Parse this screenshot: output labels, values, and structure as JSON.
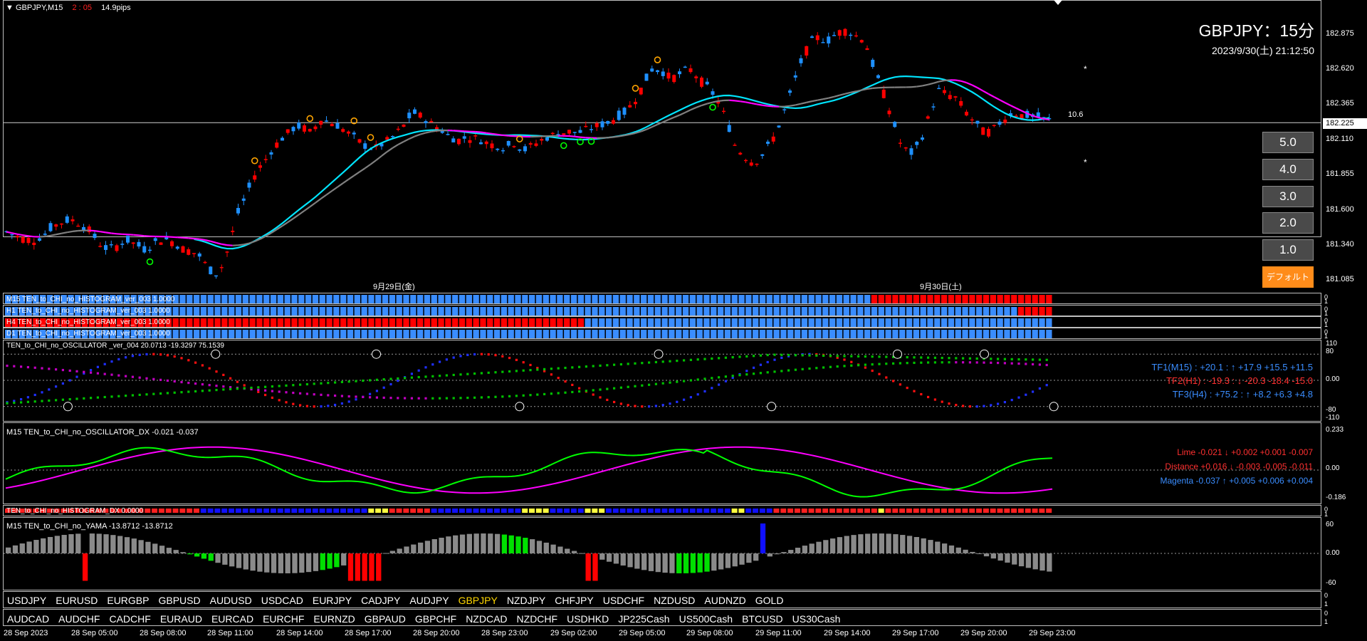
{
  "chart_header": {
    "symbol_tf": "GBPJPY,M15",
    "countdown": "2 : 05",
    "spread": "14.9pips"
  },
  "title_box": {
    "title": "GBPJPY：15分",
    "datetime": "2023/9/30(土) 21:12:50"
  },
  "price_axis": {
    "labels": [
      "182.875",
      "182.620",
      "182.365",
      "182.110",
      "181.855",
      "181.600",
      "181.340",
      "181.085"
    ],
    "current_price": "182.225",
    "current_price_value": 182.225
  },
  "spread_label": "10.6",
  "asterisks": [
    "*",
    "*"
  ],
  "scale_buttons": [
    "5.0",
    "4.0",
    "3.0",
    "2.0",
    "1.0",
    "デフォルト"
  ],
  "day_labels": [
    "9月29日(金)",
    "9月30日(土)"
  ],
  "histograms": [
    "M15 TEN_to_CHI_no_HISTOGRAM_ver_003 1.0000",
    "H1 TEN_to_CHI_no_HISTOGRAM_ver_003 1.0000",
    "H4 TEN_to_CHI_no_HISTOGRAM_ver_003 1.0000",
    "D1 TEN_to_CHI_no_HISTOGRAM_ver_003 1.0000"
  ],
  "hist_axis": [
    "0",
    "1"
  ],
  "oscillator": {
    "title": "TEN_to_CHI_no_OSCILLATOR _ver_004 20.0713 -19.3297 75.1539",
    "axis": [
      "110",
      "80",
      "0.00",
      "-80",
      "-110"
    ],
    "rows": [
      {
        "text": "TF1(M15) : +20.1 : ↑ +17.9 +15.5 +11.5",
        "color": "#3a8dff"
      },
      {
        "text": "TF2(H1) : -19.3 : ↓ -20.3 -18.4 -15.0",
        "color": "#ff3030"
      },
      {
        "text": "TF3(H4) : +75.2 : ↑ +8.2 +6.3 +4.8",
        "color": "#3a8dff"
      }
    ]
  },
  "dx": {
    "title": "M15 TEN_to_CHI_no_OSCILLATOR_DX -0.021 -0.037",
    "axis": [
      "0.233",
      "0.00",
      "-0.186"
    ],
    "rows": [
      {
        "text": "Lime -0.021 ↓ +0.002 +0.001 -0.007",
        "color": "#ff3030"
      },
      {
        "text": "Distance +0.016 ↓ -0.003 -0.005 -0.011",
        "color": "#ff3030"
      },
      {
        "text": "Magenta -0.037 ↑ +0.005 +0.006 +0.004",
        "color": "#3a8dff"
      }
    ]
  },
  "dx_hist": {
    "title": "TEN_to_CHI_no_HISTOGRAM_DX 0.0000",
    "axis": [
      "0",
      "1"
    ]
  },
  "yama": {
    "title": "M15 TEN_to_CHI_no_YAMA -13.8712 -13.8712",
    "axis": [
      "60",
      "0.00",
      "-60"
    ]
  },
  "symbols_row1": {
    "items": [
      "USDJPY",
      "EURUSD",
      "EURGBP",
      "GBPUSD",
      "AUDUSD",
      "USDCAD",
      "EURJPY",
      "CADJPY",
      "AUDJPY",
      "GBPJPY",
      "NZDJPY",
      "CHFJPY",
      "USDCHF",
      "NZDUSD",
      "AUDNZD",
      "GOLD"
    ],
    "active": "GBPJPY",
    "axis": [
      "0",
      "1"
    ]
  },
  "symbols_row2": {
    "items": [
      "AUDCAD",
      "AUDCHF",
      "CADCHF",
      "EURAUD",
      "EURCAD",
      "EURCHF",
      "EURNZD",
      "GBPAUD",
      "GBPCHF",
      "NZDCAD",
      "NZDCHF",
      "USDHKD",
      "JP225Cash",
      "US500Cash",
      "BTCUSD",
      "US30Cash"
    ],
    "axis": [
      "0",
      "1"
    ]
  },
  "time_axis": [
    "28 Sep 2023",
    "28 Sep 05:00",
    "28 Sep 08:00",
    "28 Sep 11:00",
    "28 Sep 14:00",
    "28 Sep 17:00",
    "28 Sep 20:00",
    "28 Sep 23:00",
    "29 Sep 02:00",
    "29 Sep 05:00",
    "29 Sep 08:00",
    "29 Sep 11:00",
    "29 Sep 14:00",
    "29 Sep 17:00",
    "29 Sep 20:00",
    "29 Sep 23:00"
  ],
  "colors": {
    "bull": "#1e90ff",
    "bear": "#ff0000",
    "ma_fast": "#00e5ff",
    "ma_slow_up": "#808080",
    "ma_slow_down": "#ff00ff",
    "lime": "#00ff00",
    "magenta": "#ff00ff",
    "active_symbol": "#ffd700"
  },
  "price_path": [
    181.43,
    181.4,
    181.38,
    181.37,
    181.4,
    181.47,
    181.5,
    181.52,
    181.49,
    181.44,
    181.35,
    181.3,
    181.33,
    181.37,
    181.34,
    181.3,
    181.35,
    181.38,
    181.36,
    181.31,
    181.29,
    181.25,
    181.15,
    181.12,
    181.3,
    181.55,
    181.7,
    181.86,
    181.95,
    182.05,
    182.12,
    182.18,
    182.2,
    182.15,
    182.25,
    182.23,
    182.2,
    182.15,
    182.1,
    182.05,
    182.04,
    182.08,
    182.13,
    182.2,
    182.3,
    182.27,
    182.22,
    182.18,
    182.12,
    182.1,
    182.12,
    182.11,
    182.08,
    182.06,
    182.04,
    182.08,
    182.02,
    182.06,
    182.1,
    182.13,
    182.15,
    182.16,
    182.15,
    182.18,
    182.2,
    182.22,
    182.26,
    182.3,
    182.38,
    182.5,
    182.62,
    182.6,
    182.55,
    182.58,
    182.62,
    182.55,
    182.48,
    182.4,
    182.25,
    182.05,
    181.98,
    181.93,
    182.0,
    182.1,
    182.25,
    182.45,
    182.65,
    182.8,
    182.85,
    182.82,
    182.88,
    182.9,
    182.86,
    182.83,
    182.62,
    182.45,
    182.25,
    182.05,
    182.0,
    182.08,
    182.28,
    182.46,
    182.43,
    182.4,
    182.3,
    182.22,
    182.15,
    182.18,
    182.25,
    182.3,
    182.28,
    182.27,
    182.26,
    182.24
  ]
}
